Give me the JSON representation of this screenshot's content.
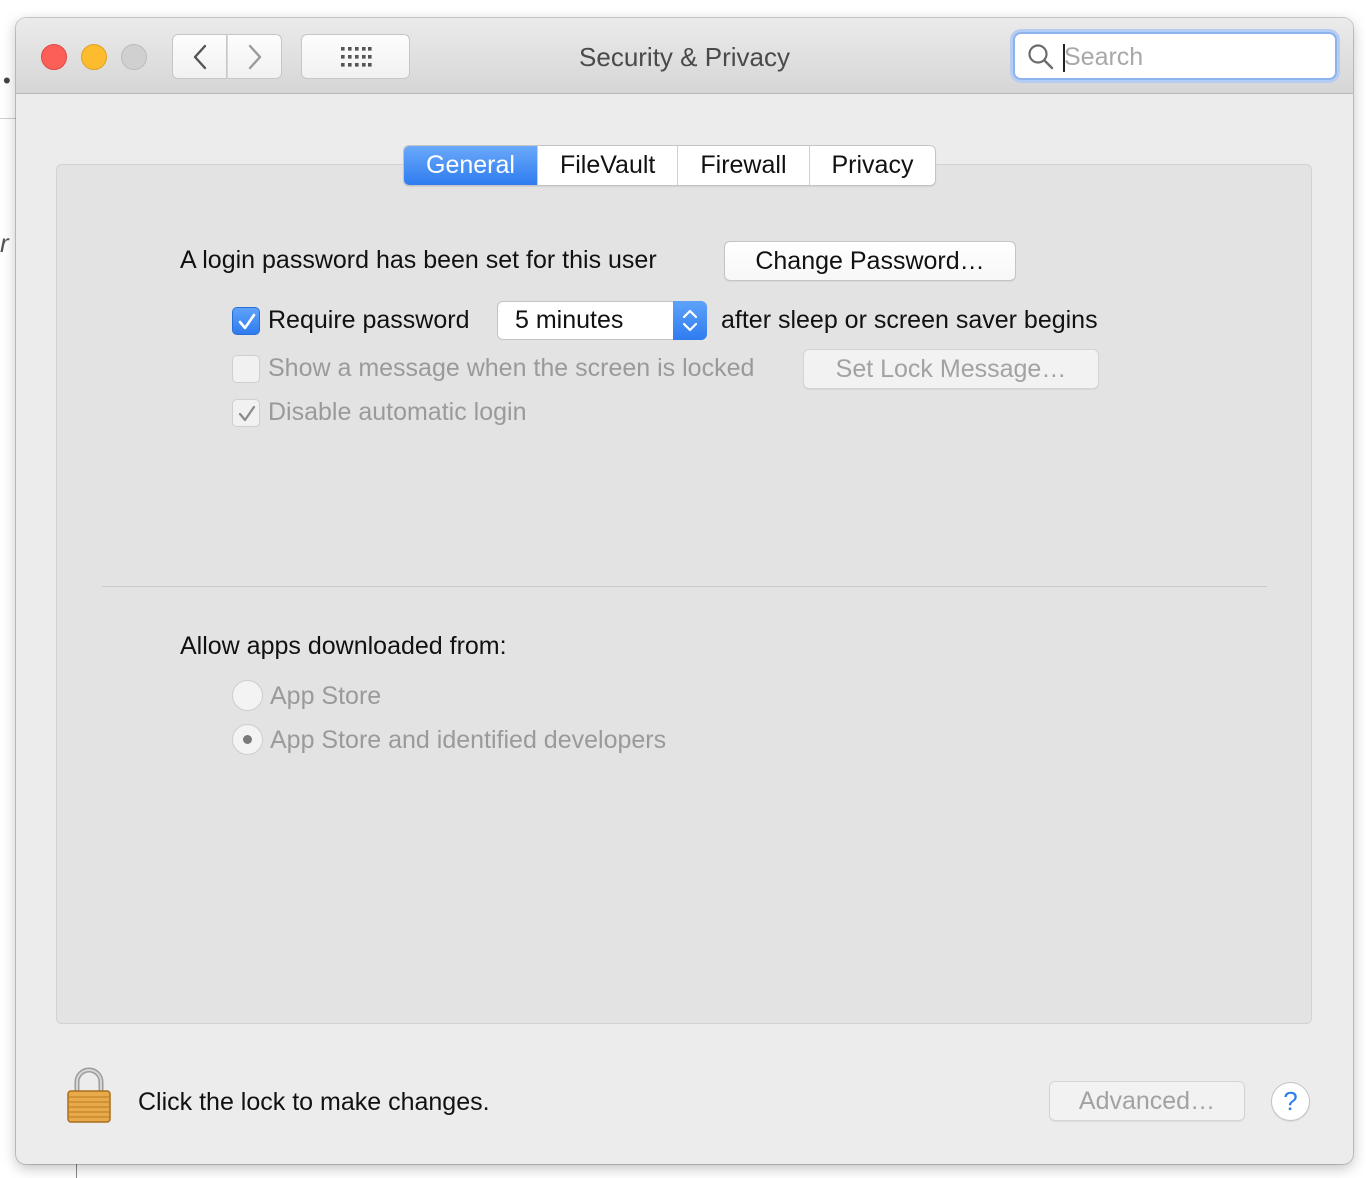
{
  "window": {
    "title": "Security & Privacy",
    "search_placeholder": "Search"
  },
  "titlebar_icons": {
    "close": "close-traffic-light",
    "minimize": "minimize-traffic-light",
    "zoom": "zoom-traffic-light",
    "back": "chevron-left-icon",
    "forward": "chevron-right-icon",
    "show_all": "grid-icon",
    "search": "search-icon"
  },
  "tabs": [
    {
      "label": "General",
      "active": true
    },
    {
      "label": "FileVault",
      "active": false
    },
    {
      "label": "Firewall",
      "active": false
    },
    {
      "label": "Privacy",
      "active": false
    }
  ],
  "general": {
    "login_password_text": "A login password has been set for this user",
    "change_password_button": "Change Password…",
    "require_password": {
      "label": "Require password",
      "checked": true
    },
    "require_password_delay": "5 minutes",
    "require_password_suffix": "after sleep or screen saver begins",
    "show_message": {
      "label": "Show a message when the screen is locked",
      "checked": false,
      "enabled": false
    },
    "set_lock_message_button": "Set Lock Message…",
    "disable_auto_login": {
      "label": "Disable automatic login",
      "checked": true,
      "enabled": false
    }
  },
  "downloads": {
    "heading": "Allow apps downloaded from:",
    "options": [
      {
        "label": "App Store",
        "selected": false
      },
      {
        "label": "App Store and identified developers",
        "selected": true
      }
    ]
  },
  "footer": {
    "lock_text": "Click the lock to make changes.",
    "advanced_button": "Advanced…",
    "help_button": "?"
  },
  "colors": {
    "accent": "#2f7cf0",
    "close": "#fc5f57",
    "minimize": "#fdbc2e",
    "zoom_disabled": "#d0d0d0"
  }
}
